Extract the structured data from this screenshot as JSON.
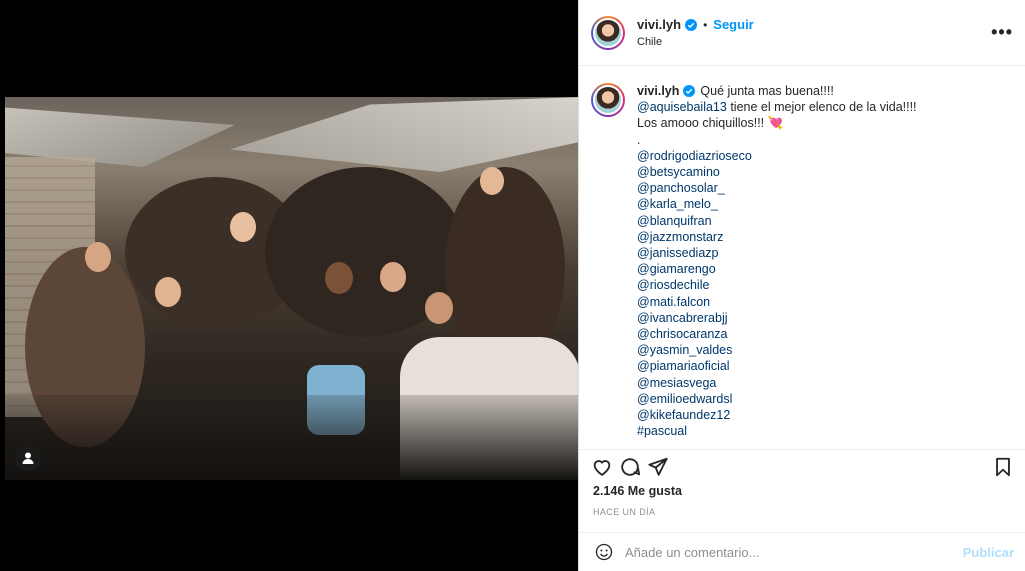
{
  "post": {
    "username": "vivi.lyh",
    "follow_label": "Seguir",
    "separator": "•",
    "location": "Chile",
    "more_label": "•••"
  },
  "caption": {
    "username": "vivi.lyh",
    "line1": "Qué junta mas buena!!!!",
    "line2_mention": "@aquisebaila13",
    "line2_rest": " tiene el mejor elenco de la vida!!!!",
    "line3": "Los amooo chiquillos!!!",
    "line3_emoji": "💘",
    "dot_line": ".",
    "mentions": [
      "@rodrigodiazrioseco",
      "@betsycamino",
      "@panchosolar_",
      "@karla_melo_",
      "@blanquifran",
      "@jazzmonstarz",
      "@janissediazp",
      "@giamarengo",
      "@riosdechile",
      "@mati.falcon",
      "@ivancabrerabjj",
      "@chrisocaranza",
      "@yasmin_valdes",
      "@piamariaoficial",
      "@mesiasvega",
      "@emilioedwardsl",
      "@kikefaundez12"
    ],
    "hashtag": "#pascual"
  },
  "engagement": {
    "likes": "2.146 Me gusta",
    "time": "HACE UN DÍA"
  },
  "comment": {
    "placeholder": "Añade un comentario...",
    "publish_label": "Publicar"
  },
  "colors": {
    "link": "#0095f6",
    "mention": "#00376b",
    "publish_disabled": "#b2dffc"
  }
}
